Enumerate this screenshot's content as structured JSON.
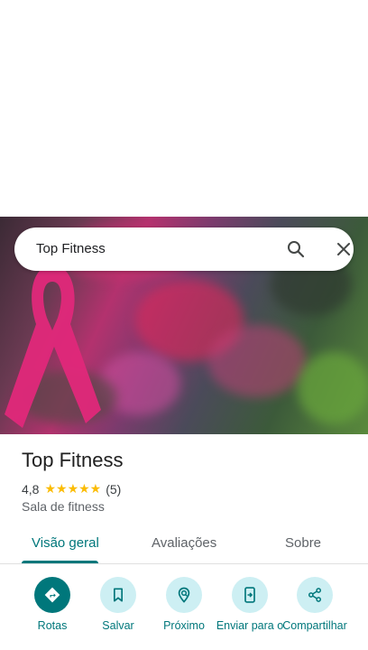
{
  "search": {
    "query": "Top Fitness"
  },
  "place": {
    "name": "Top Fitness",
    "rating": "4,8",
    "stars": "★★★★★",
    "review_count": "(5)",
    "category": "Sala de fitness"
  },
  "tabs": [
    {
      "label": "Visão geral",
      "active": true
    },
    {
      "label": "Avaliações",
      "active": false
    },
    {
      "label": "Sobre",
      "active": false
    }
  ],
  "actions": [
    {
      "label": "Rotas",
      "icon": "directions-icon"
    },
    {
      "label": "Salvar",
      "icon": "bookmark-icon"
    },
    {
      "label": "Próximo",
      "icon": "nearby-icon"
    },
    {
      "label": "Enviar para o",
      "icon": "send-to-phone-icon"
    },
    {
      "label": "Compartilhar",
      "icon": "share-icon"
    }
  ],
  "colors": {
    "accent": "#00777b",
    "chip_bg": "#cdeff3",
    "star": "#fbbc04"
  }
}
